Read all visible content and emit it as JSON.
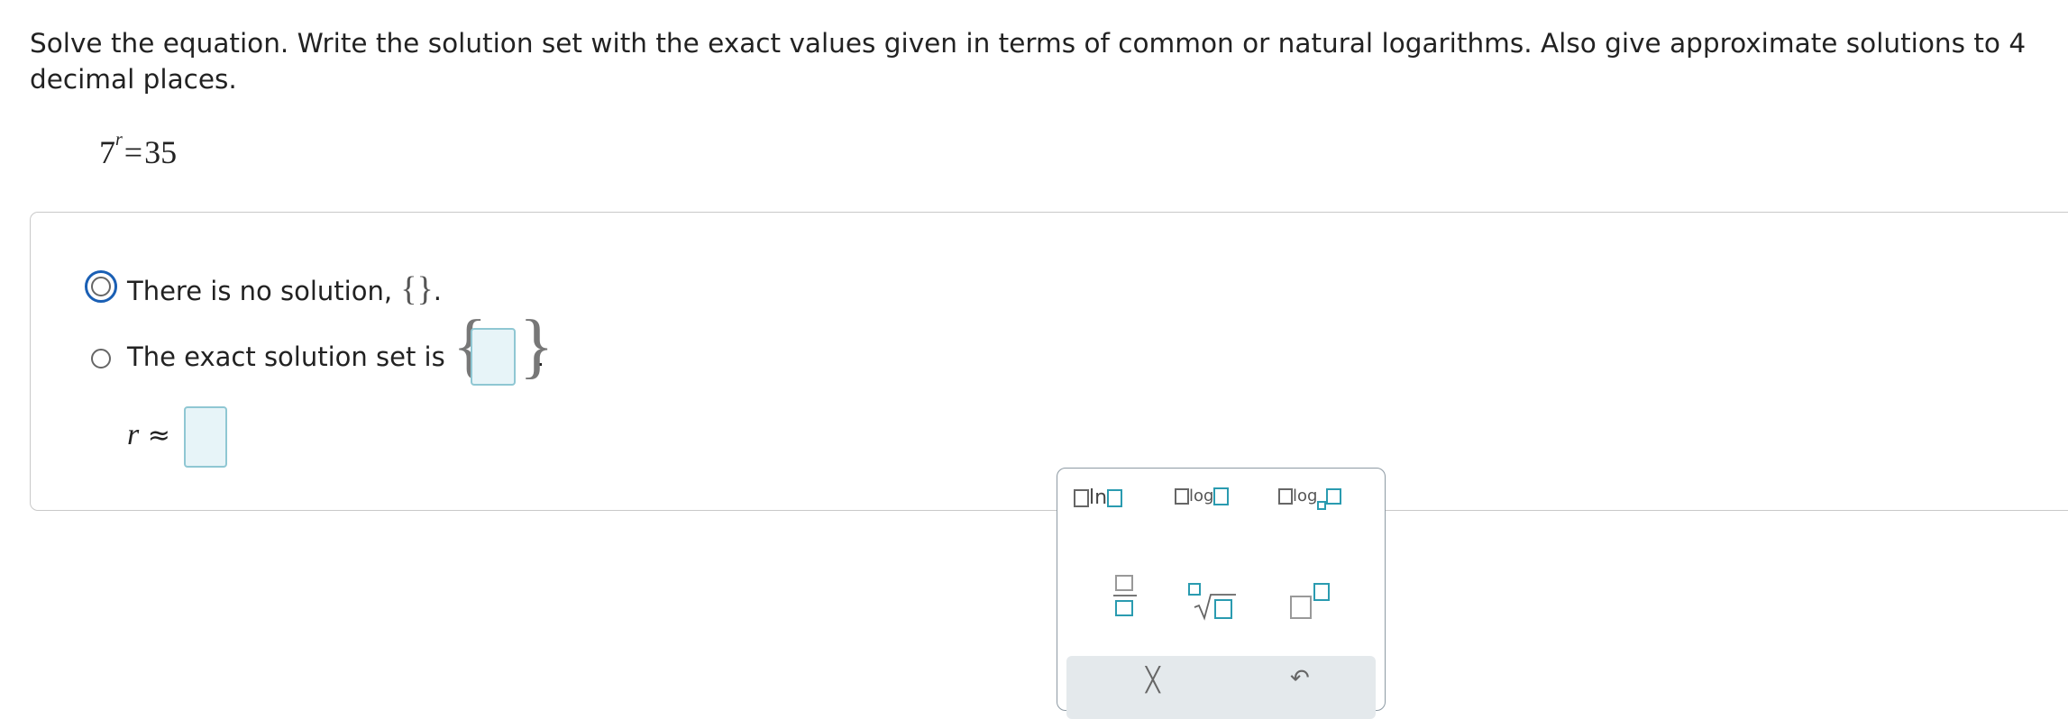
{
  "question": {
    "text": "Solve the equation. Write the solution set with the exact values given in terms of common or natural logarithms. Also give approximate solutions to 4 decimal places."
  },
  "equation": {
    "base": "7",
    "exponent": "r",
    "equals": "=",
    "rhs": "35"
  },
  "options": {
    "no_solution": {
      "label": "There is no solution,",
      "braces": "{}",
      "period": ".",
      "selected": false,
      "focused": true
    },
    "exact": {
      "label": "The exact solution set is",
      "open_brace": "{",
      "close_brace": "}",
      "period": ".",
      "input_value": "",
      "selected": false
    }
  },
  "approx": {
    "variable": "r",
    "symbol": "≈",
    "input_value": ""
  },
  "palette": {
    "ln_text": "ln",
    "log_text": "log",
    "logbase_text": "log",
    "clear_icon": "x-icon",
    "undo_icon": "undo-icon",
    "clear_glyph": "╳",
    "undo_glyph": "↶"
  }
}
